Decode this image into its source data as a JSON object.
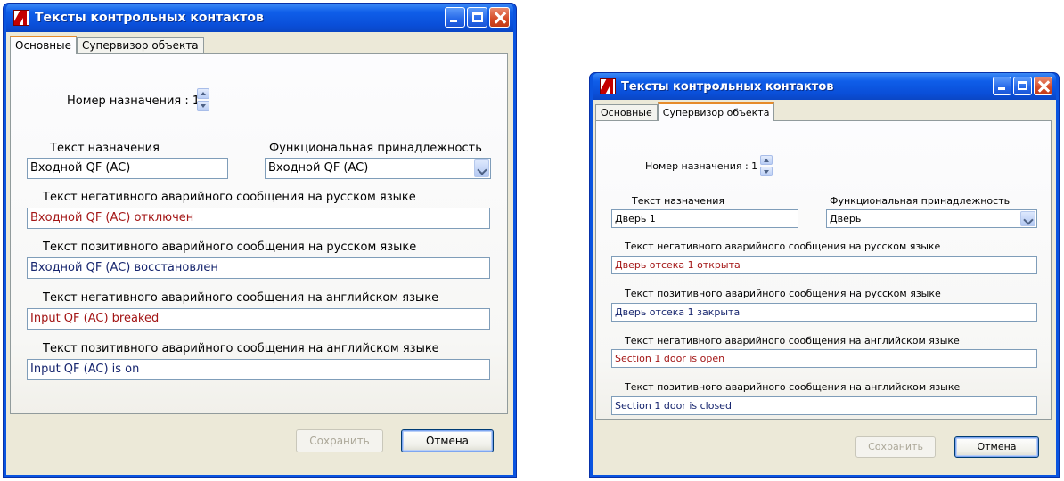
{
  "windows": [
    {
      "title": "Тексты контрольных контактов",
      "tabs": [
        "Основные",
        "Супервизор объекта"
      ],
      "active_tab_index": 0,
      "number_label": "Номер назначения : 1",
      "purpose_text_label": "Текст назначения",
      "purpose_text_value": "Входной QF (AC)",
      "function_label": "Функциональная принадлежность",
      "function_value": "Входной QF (AC)",
      "neg_ru_label": "Текст негативного аварийного сообщения на русском языке",
      "neg_ru_value": "Входной QF (AC) отключен",
      "pos_ru_label": "Текст позитивного аварийного сообщения на русском языке",
      "pos_ru_value": "Входной QF (AC) восстановлен",
      "neg_en_label": "Текст негативного аварийного сообщения на английском языке",
      "neg_en_value": "Input QF (AC) breaked",
      "pos_en_label": "Текст позитивного аварийного сообщения на английском языке",
      "pos_en_value": "Input QF (AC) is on",
      "save_label": "Сохранить",
      "cancel_label": "Отмена"
    },
    {
      "title": "Тексты контрольных контактов",
      "tabs": [
        "Основные",
        "Супервизор объекта"
      ],
      "active_tab_index": 1,
      "number_label": "Номер назначения : 1",
      "purpose_text_label": "Текст назначения",
      "purpose_text_value": "Дверь 1",
      "function_label": "Функциональная принадлежность",
      "function_value": "Дверь",
      "neg_ru_label": "Текст негативного аварийного сообщения на русском языке",
      "neg_ru_value": "Дверь отсека 1 открыта",
      "pos_ru_label": "Текст позитивного аварийного сообщения на русском языке",
      "pos_ru_value": "Дверь отсека 1 закрыта",
      "neg_en_label": "Текст негативного аварийного сообщения на английском языке",
      "neg_en_value": "Section 1 door is open",
      "pos_en_label": "Текст позитивного аварийного сообщения на английском языке",
      "pos_en_value": "Section 1 door is closed",
      "save_label": "Сохранить",
      "cancel_label": "Отмена"
    }
  ],
  "colors": {
    "titlebar": "#0a54e0",
    "negative_text": "#a31515",
    "positive_text": "#16256e",
    "dialog_bg": "#ece9d8"
  },
  "icons": [
    "app-icon",
    "minimize-icon",
    "maximize-icon",
    "close-icon",
    "spin-up-icon",
    "spin-down-icon",
    "chevron-down-icon"
  ]
}
